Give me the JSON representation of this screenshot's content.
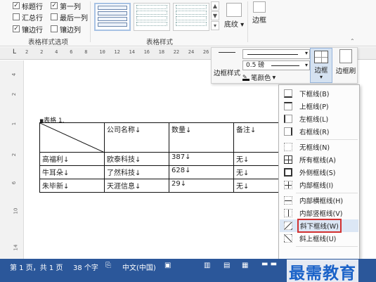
{
  "ribbon": {
    "options": {
      "header_row": "标题行",
      "first_column": "第一列",
      "total_row": "汇总行",
      "last_column": "最后一列",
      "banded_rows": "镶边行",
      "banded_columns": "镶边列",
      "group_label": "表格样式选项"
    },
    "styles_group_label": "表格样式",
    "shading_label": "底纹",
    "borders_label": "边框"
  },
  "ruler": {
    "numbers": "2    2    4    6    8    10   12   14   16   18   22   24   26"
  },
  "document": {
    "caption": "▪表格 1.",
    "header": [
      "",
      "公司名称↓",
      "数量↓",
      "备注↓"
    ],
    "rows": [
      [
        "高福利↓",
        "欧泰科技↓",
        "387↓",
        "无↓"
      ],
      [
        "牛耳朵↓",
        "了然科技↓",
        "628↓",
        "无↓"
      ],
      [
        "朱毕新↓",
        "天涯信息↓",
        "29↓",
        "无↓"
      ]
    ]
  },
  "border_panel": {
    "border_styles_label": "边框样式",
    "weight": "0.5 磅",
    "pen_color_label": "笔颜色",
    "borders_button_label": "边框",
    "border_painter_label": "边框刷"
  },
  "border_menu": {
    "items": [
      "下框线(B)",
      "上框线(P)",
      "左框线(L)",
      "右框线(R)",
      "无框线(N)",
      "所有框线(A)",
      "外侧框线(S)",
      "内部框线(I)",
      "内部横框线(H)",
      "内部竖框线(V)",
      "斜下框线(W)",
      "斜上框线(U)"
    ],
    "highlighted_item": "斜下框线(W)"
  },
  "status_bar": {
    "page": "第 1 页，共 1 页",
    "words": "38 个字",
    "language": "中文(中国)"
  },
  "watermark": "最需教育"
}
